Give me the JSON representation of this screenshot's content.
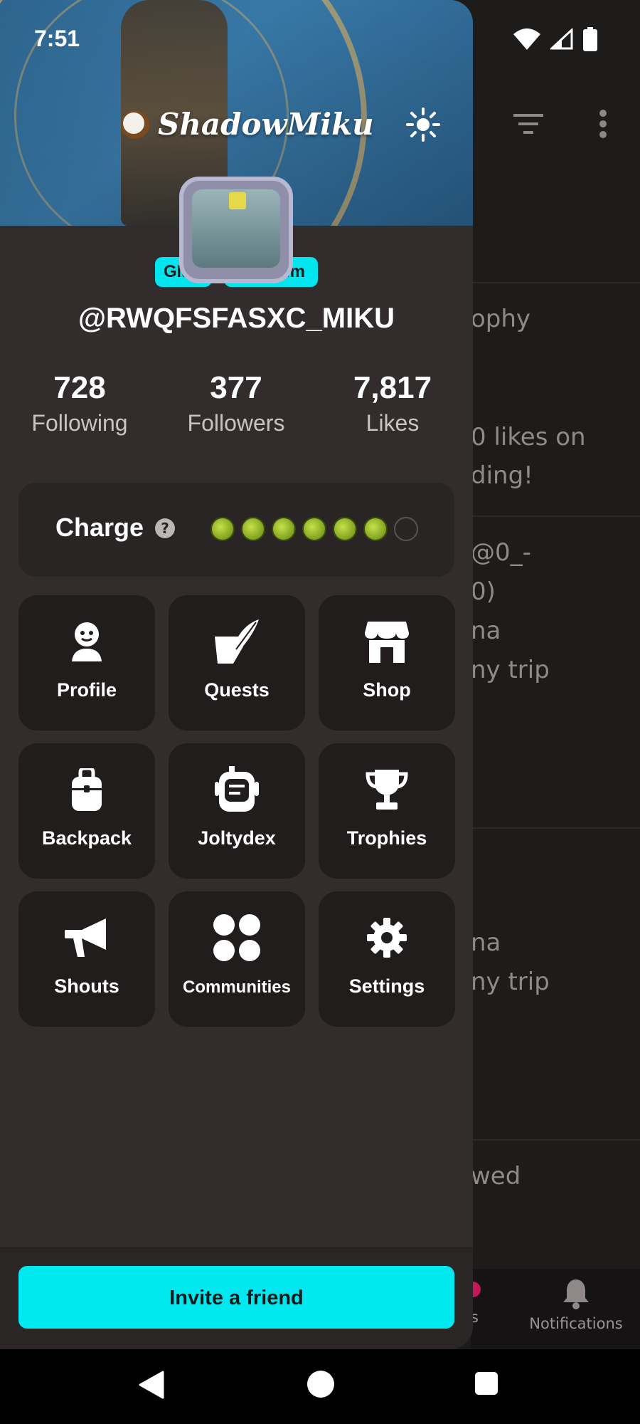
{
  "status_bar": {
    "time": "7:51"
  },
  "background_app": {
    "texts": [
      "ophy",
      "0 likes on",
      "ding!",
      "@0_-",
      "0)",
      "na",
      "ny trip",
      "na",
      "ny trip",
      "wed"
    ],
    "bottom_nav": {
      "partial_label": "s",
      "notifications_label": "Notifications"
    }
  },
  "drawer": {
    "display_name": "ShadowMiku",
    "tags": [
      "GMR",
      "He / Him"
    ],
    "username": "@RWQFSFASXC_MIKU",
    "stats": [
      {
        "value": "728",
        "label": "Following"
      },
      {
        "value": "377",
        "label": "Followers"
      },
      {
        "value": "7,817",
        "label": "Likes"
      }
    ],
    "charge": {
      "label": "Charge",
      "help_icon": "?",
      "filled": 6,
      "total": 7
    },
    "menu": [
      {
        "label": "Profile",
        "icon": "face-icon"
      },
      {
        "label": "Quests",
        "icon": "quest-quill-icon"
      },
      {
        "label": "Shop",
        "icon": "storefront-icon"
      },
      {
        "label": "Backpack",
        "icon": "backpack-icon"
      },
      {
        "label": "Joltydex",
        "icon": "joltydex-icon"
      },
      {
        "label": "Trophies",
        "icon": "trophy-icon"
      },
      {
        "label": "Shouts",
        "icon": "megaphone-icon"
      },
      {
        "label": "Communities",
        "icon": "communities-icon"
      },
      {
        "label": "Settings",
        "icon": "gear-icon"
      }
    ],
    "invite_button": "Invite a friend"
  },
  "colors": {
    "accent": "#00e8f0",
    "drawer_bg": "#322c2c",
    "tile_bg": "#211d1d",
    "charge_green": "#9bbf2a"
  }
}
